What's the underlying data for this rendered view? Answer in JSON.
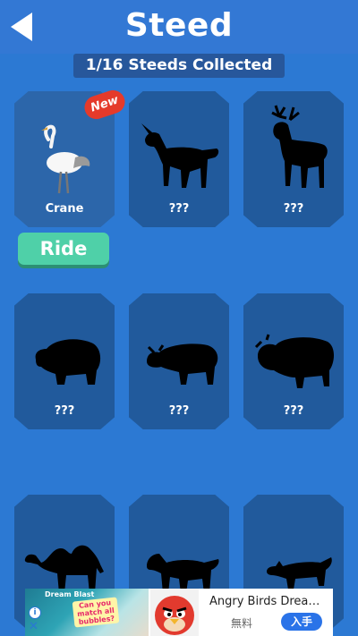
{
  "header": {
    "title": "Steed"
  },
  "collection": {
    "summary": "1/16 Steeds Collected"
  },
  "steeds": [
    {
      "name": "Crane",
      "badge": "New",
      "icon": "crane"
    },
    {
      "name": "???",
      "icon": "unicorn-silhouette"
    },
    {
      "name": "???",
      "icon": "deer-silhouette"
    },
    {
      "name": "???",
      "icon": "bear-silhouette"
    },
    {
      "name": "???",
      "icon": "bull-silhouette"
    },
    {
      "name": "???",
      "icon": "yak-silhouette"
    },
    {
      "name": "???",
      "icon": "camel-silhouette"
    },
    {
      "name": "???",
      "icon": "horse-silhouette"
    },
    {
      "name": "???",
      "icon": "wolf-silhouette"
    }
  ],
  "ride_button": {
    "label": "Ride"
  },
  "ad": {
    "brand": "Dream Blast",
    "question": "Can you match all bubbles?",
    "app_name": "Angry Birds Dream ...",
    "price": "無料",
    "get_label": "入手"
  },
  "colors": {
    "background": "#2c79d3",
    "card": "#215a9c",
    "ride": "#4fd0a8",
    "new_badge": "#e53a2a"
  }
}
